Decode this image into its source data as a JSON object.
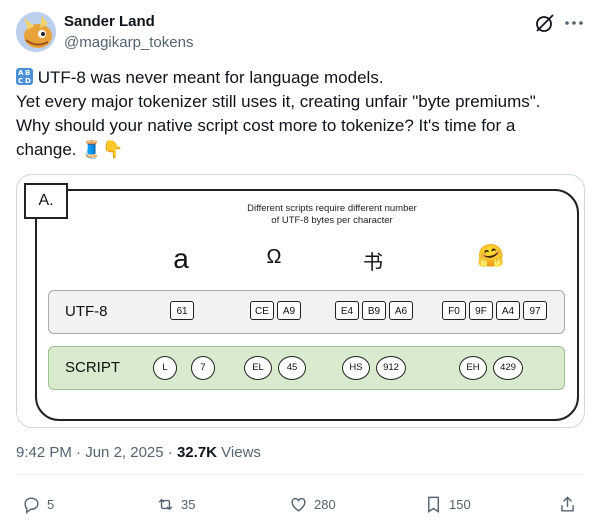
{
  "author": {
    "name": "Sander Land",
    "handle": "@magikarp_tokens"
  },
  "tweet": {
    "lines": [
      " UTF-8 was never meant for language models.",
      "Yet every major tokenizer still uses it, creating unfair \"byte premiums\".",
      "Why should your native script cost more to tokenize? It's time for a",
      "change. "
    ],
    "emoji_label_letters": [
      "A",
      "B",
      "C",
      "D"
    ],
    "trailing_emojis": [
      "🧵",
      "👇"
    ]
  },
  "figure": {
    "tag": "A.",
    "title_line1": "Different scripts require different number",
    "title_line2": "of UTF-8 bytes per character",
    "glyphs": [
      "a",
      "Ω",
      "书",
      "🤗"
    ],
    "utf_row": {
      "label": "UTF-8",
      "groups": [
        [
          "61"
        ],
        [
          "CE",
          "A9"
        ],
        [
          "E4",
          "B9",
          "A6"
        ],
        [
          "F0",
          "9F",
          "A4",
          "97"
        ]
      ]
    },
    "script_row": {
      "label": "SCRIPT",
      "groups": [
        [
          "L",
          "7"
        ],
        [
          "EL",
          "45"
        ],
        [
          "HS",
          "912"
        ],
        [
          "EH",
          "429"
        ]
      ]
    }
  },
  "meta": {
    "time": "9:42 PM",
    "date": "Jun 2, 2025",
    "views_count": "32.7K",
    "views_label": "Views"
  },
  "actions": {
    "replies": "5",
    "reposts": "35",
    "likes": "280",
    "bookmarks": "150"
  },
  "colors": {
    "utf_row_bg": "#f2f2f2",
    "script_row_bg": "#d8ebcf",
    "secondary_text": "#536471"
  }
}
